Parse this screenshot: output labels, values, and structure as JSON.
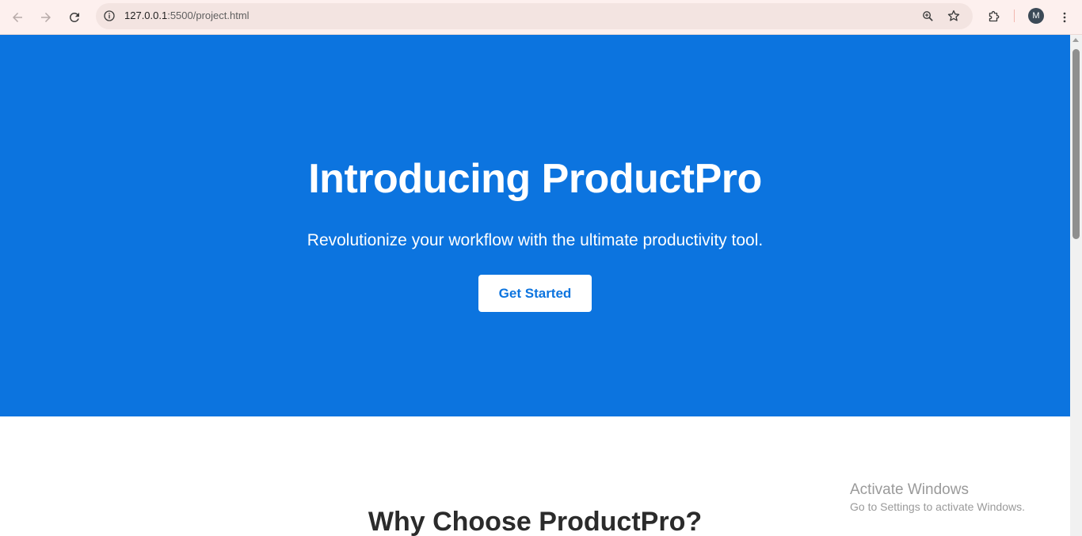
{
  "browser": {
    "url_host": "127.0.0.1",
    "url_rest": ":5500/project.html",
    "avatar_initial": "M"
  },
  "hero": {
    "title": "Introducing ProductPro",
    "subtitle": "Revolutionize your workflow with the ultimate productivity tool.",
    "cta_label": "Get Started"
  },
  "features": {
    "title": "Why Choose ProductPro?"
  },
  "watermark": {
    "line1": "Activate Windows",
    "line2": "Go to Settings to activate Windows."
  },
  "icons": [
    "back-icon",
    "forward-icon",
    "reload-icon",
    "site-info-icon",
    "zoom-icon",
    "bookmark-star-icon",
    "extensions-icon",
    "menu-kebab-icon"
  ],
  "colors": {
    "hero_bg": "#0c74df",
    "cta_text": "#0c74df",
    "toolbar_bg": "#fdf0ee"
  }
}
